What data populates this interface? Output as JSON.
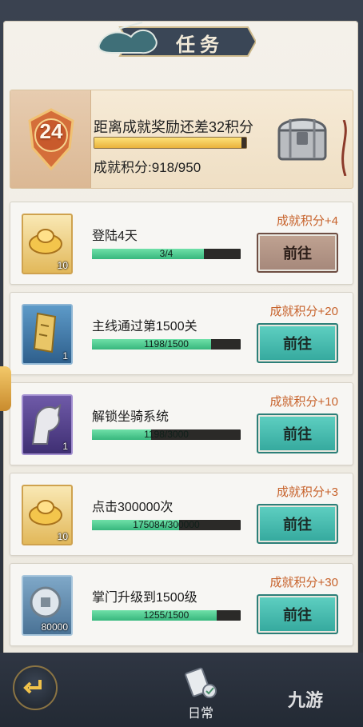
{
  "title": "任务",
  "achievement": {
    "level": "24",
    "remaining_text": "距离成就奖励还差32积分",
    "score_text": "成就积分:918/950",
    "progress": 0.966
  },
  "tasks": [
    {
      "name": "登陆4天",
      "reward": "成就积分+4",
      "progress_text": "3/4",
      "progress": 0.75,
      "item_count": "10",
      "item_icon": "gold-ingot-icon",
      "button_label": "前往",
      "button_style": "brown"
    },
    {
      "name": "主线通过第1500关",
      "reward": "成就积分+20",
      "progress_text": "1198/1500",
      "progress": 0.799,
      "item_count": "1",
      "item_icon": "scroll-token-icon",
      "button_label": "前往",
      "button_style": "teal"
    },
    {
      "name": "解锁坐骑系统",
      "reward": "成就积分+10",
      "progress_text": "1198/3000",
      "progress": 0.4,
      "item_count": "1",
      "item_icon": "white-horse-icon",
      "button_label": "前往",
      "button_style": "teal"
    },
    {
      "name": "点击300000次",
      "reward": "成就积分+3",
      "progress_text": "175084/300000",
      "progress": 0.584,
      "item_count": "10",
      "item_icon": "gold-ingot-icon",
      "button_label": "前往",
      "button_style": "teal"
    },
    {
      "name": "掌门升级到1500级",
      "reward": "成就积分+30",
      "progress_text": "1255/1500",
      "progress": 0.837,
      "item_count": "80000",
      "item_icon": "silver-coin-icon",
      "button_label": "前往",
      "button_style": "teal"
    }
  ],
  "bottom": {
    "daily_label": "日常",
    "watermark": "九游"
  },
  "colors": {
    "reward": "#c7622b",
    "progress_green": "#37b77d",
    "button_teal": "#34a89d"
  }
}
